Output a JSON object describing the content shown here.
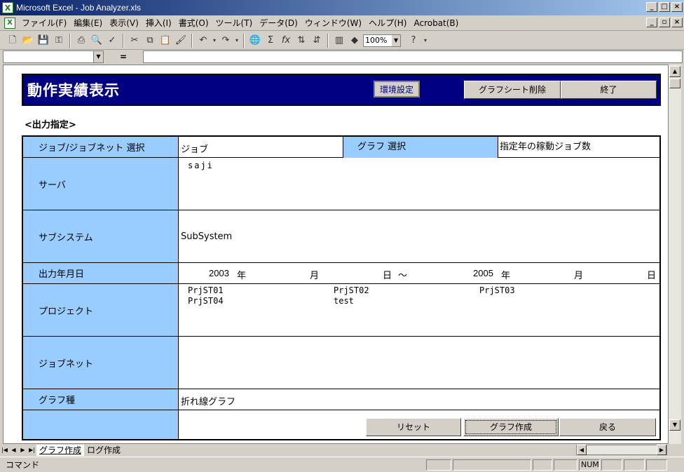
{
  "window": {
    "title": "Microsoft Excel - Job Analyzer.xls",
    "app_icon": "X"
  },
  "menu": [
    "ファイル(F)",
    "編集(E)",
    "表示(V)",
    "挿入(I)",
    "書式(O)",
    "ツール(T)",
    "データ(D)",
    "ウィンドウ(W)",
    "ヘルプ(H)",
    "Acrobat(B)"
  ],
  "toolbar": {
    "zoom": "100%"
  },
  "formula": {
    "equals": "="
  },
  "header": {
    "title": "動作実績表示",
    "settings_button": "環境設定",
    "delete_graph_button": "グラフシート削除",
    "exit_button": "終了"
  },
  "section_label": "<出力指定>",
  "form": {
    "job_select_label": "ジョブ/ジョブネット 選択",
    "job_select_value": "ジョブ",
    "graph_select_label": "グラフ 選択",
    "graph_select_value": "指定年の稼動ジョブ数",
    "server_label": "サーバ",
    "server_value": "saji",
    "subsystem_label": "サブシステム",
    "subsystem_value": "SubSystem",
    "date_label": "出力年月日",
    "date": {
      "start_year": "2003",
      "year_unit": "年",
      "month_unit": "月",
      "day_unit": "日",
      "range_sep": "～",
      "end_year": "2005"
    },
    "project_label": "プロジェクト",
    "projects": [
      "PrjST01",
      "PrjST02",
      "PrjST03",
      "PrjST04",
      "test"
    ],
    "jobnet_label": "ジョブネット",
    "graph_type_label": "グラフ種",
    "graph_type_value": "折れ線グラフ",
    "reset_button": "リセット",
    "create_graph_button": "グラフ作成",
    "back_button": "戻る"
  },
  "tabs": [
    "グラフ作成",
    "ログ作成"
  ],
  "status": {
    "mode": "コマンド",
    "num": "NUM"
  }
}
